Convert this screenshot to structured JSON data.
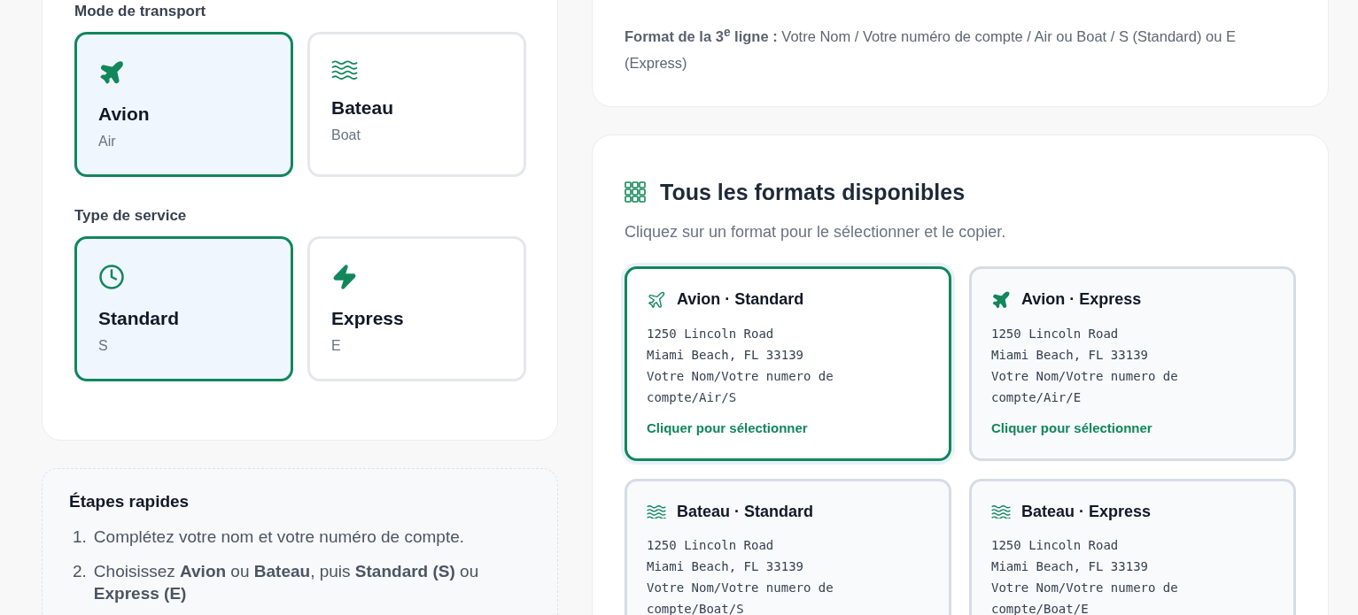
{
  "transport": {
    "label": "Mode de transport",
    "options": [
      {
        "kind": "air",
        "title": "Avion",
        "subtitle": "Air",
        "selected": true
      },
      {
        "kind": "boat",
        "title": "Bateau",
        "subtitle": "Boat",
        "selected": false
      }
    ]
  },
  "service": {
    "label": "Type de service",
    "options": [
      {
        "kind": "standard",
        "title": "Standard",
        "subtitle": "S",
        "selected": true
      },
      {
        "kind": "express",
        "title": "Express",
        "subtitle": "E",
        "selected": false
      }
    ]
  },
  "steps": {
    "title": "Étapes rapides",
    "items": [
      {
        "number": "1.",
        "text": "Complétez votre nom et votre numéro de compte."
      },
      {
        "number": "2.",
        "text": "Choisissez **Avion** ou **Bateau**, puis **Standard (S)** ou **Express (E)**"
      }
    ]
  },
  "format_note": "**Format de la 3$^{e}$ ligne :** Votre Nom / Votre numéro de compte / Air ou Boat / S (Standard) ou E (Express)",
  "formats": {
    "title": "Tous les formats disponibles",
    "subtitle": "Cliquez sur un format pour le sélectionner et le copier.",
    "cards": [
      {
        "kind": "air-standard",
        "title": "Avion · Standard",
        "lines": [
          "1250 Lincoln Road",
          "Miami Beach, FL 33139",
          "Votre Nom/Votre numero de compte/Air/S"
        ],
        "action": "Cliquer pour sélectionner",
        "selected": true
      },
      {
        "kind": "air-express",
        "title": "Avion · Express",
        "lines": [
          "1250 Lincoln Road",
          "Miami Beach, FL 33139",
          "Votre Nom/Votre numero de compte/Air/E"
        ],
        "action": "Cliquer pour sélectionner",
        "selected": false
      },
      {
        "kind": "boat-standard",
        "title": "Bateau · Standard",
        "lines": [
          "1250 Lincoln Road",
          "Miami Beach, FL 33139",
          "Votre Nom/Votre numero de compte/Boat/S"
        ],
        "selected": false
      },
      {
        "kind": "boat-express",
        "title": "Bateau · Express",
        "lines": [
          "1250 Lincoln Road",
          "Miami Beach, FL 33139",
          "Votre Nom/Votre numero de compte/Boat/E"
        ],
        "selected": false
      }
    ]
  }
}
